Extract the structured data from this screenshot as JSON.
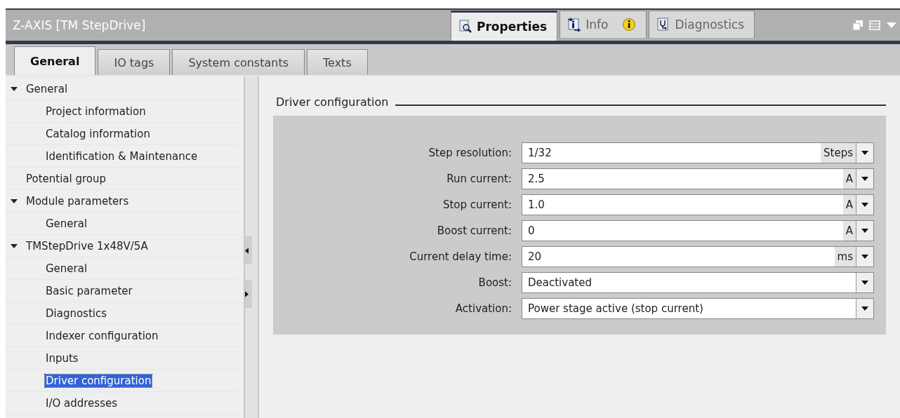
{
  "window": {
    "title": "Z-AXIS [TM StepDrive]"
  },
  "inspector_tabs": [
    {
      "label": "Properties",
      "kind": "properties",
      "selected": true,
      "badge": false
    },
    {
      "label": "Info",
      "kind": "info",
      "selected": false,
      "badge": true
    },
    {
      "label": "Diagnostics",
      "kind": "diagnostics",
      "selected": false,
      "badge": false
    }
  ],
  "tabs": [
    {
      "label": "General",
      "selected": true
    },
    {
      "label": "IO tags",
      "selected": false
    },
    {
      "label": "System constants",
      "selected": false
    },
    {
      "label": "Texts",
      "selected": false
    }
  ],
  "tree": [
    {
      "label": "General",
      "expanded": true,
      "selected": false,
      "children": [
        {
          "label": "Project information",
          "selected": false
        },
        {
          "label": "Catalog information",
          "selected": false
        },
        {
          "label": "Identification & Maintenance",
          "selected": false
        }
      ]
    },
    {
      "label": "Potential group",
      "selected": false
    },
    {
      "label": "Module parameters",
      "expanded": true,
      "selected": false,
      "children": [
        {
          "label": "General",
          "selected": false
        }
      ]
    },
    {
      "label": "TMStepDrive 1x48V/5A",
      "expanded": true,
      "selected": false,
      "children": [
        {
          "label": "General",
          "selected": false
        },
        {
          "label": "Basic parameter",
          "selected": false
        },
        {
          "label": "Diagnostics",
          "selected": false
        },
        {
          "label": "Indexer configuration",
          "selected": false
        },
        {
          "label": "Inputs",
          "selected": false
        },
        {
          "label": "Driver configuration",
          "selected": true
        },
        {
          "label": "I/O addresses",
          "selected": false
        }
      ]
    }
  ],
  "section": {
    "title": "Driver configuration",
    "fields": [
      {
        "label": "Step resolution:",
        "value": "1/32",
        "unit": "Steps",
        "kind": "unit"
      },
      {
        "label": "Run current:",
        "value": "2.5",
        "unit": "A",
        "kind": "unit"
      },
      {
        "label": "Stop current:",
        "value": "1.0",
        "unit": "A",
        "kind": "unit"
      },
      {
        "label": "Boost current:",
        "value": "0",
        "unit": "A",
        "kind": "unit"
      },
      {
        "label": "Current delay time:",
        "value": "20",
        "unit": "ms",
        "kind": "unit"
      },
      {
        "label": "Boost:",
        "value": "Deactivated",
        "kind": "dropdown"
      },
      {
        "label": "Activation:",
        "value": "Power stage active (stop current)",
        "kind": "dropdown"
      }
    ]
  }
}
